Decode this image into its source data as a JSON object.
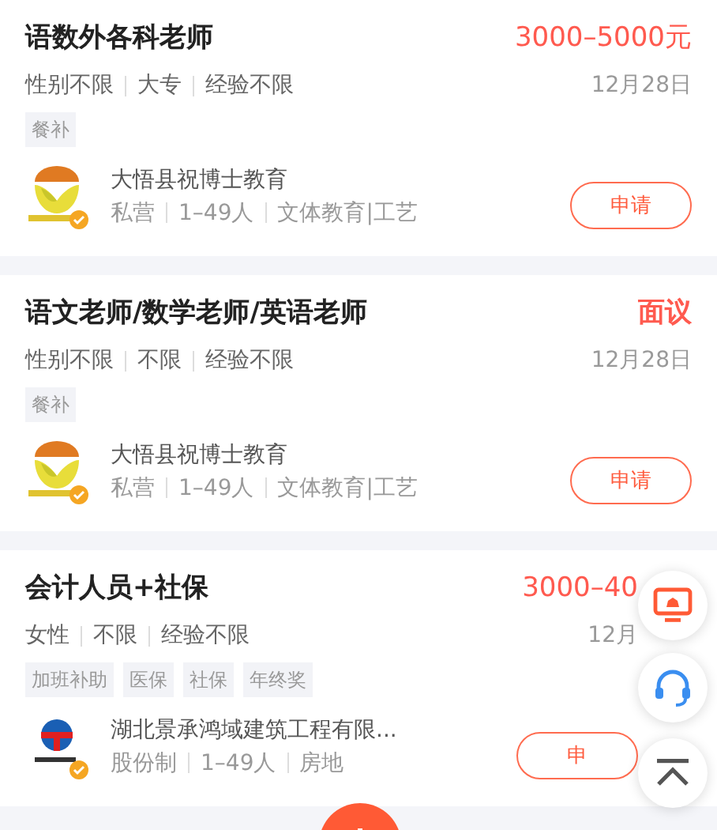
{
  "jobs": [
    {
      "title": "语数外各科老师",
      "salary": "3000–5000元",
      "requirements": [
        "性别不限",
        "大专",
        "经验不限"
      ],
      "date": "12月28日",
      "tags": [
        "餐补"
      ],
      "company": {
        "name": "大悟县祝博士教育",
        "kind": "education",
        "details": [
          "私营",
          "1–49人",
          "文体教育|工艺"
        ]
      },
      "apply": "申请"
    },
    {
      "title": "语文老师/数学老师/英语老师",
      "salary": "面议",
      "requirements": [
        "性别不限",
        "不限",
        "经验不限"
      ],
      "date": "12月28日",
      "tags": [
        "餐补"
      ],
      "company": {
        "name": "大悟县祝博士教育",
        "kind": "education",
        "details": [
          "私营",
          "1–49人",
          "文体教育|工艺"
        ]
      },
      "apply": "申请"
    },
    {
      "title": "会计人员+社保",
      "salary": "3000–40",
      "requirements": [
        "女性",
        "不限",
        "经验不限"
      ],
      "date": "12月",
      "tags": [
        "加班补助",
        "医保",
        "社保",
        "年终奖"
      ],
      "company": {
        "name": "湖北景承鸿域建筑工程有限...",
        "kind": "construction",
        "details": [
          "股份制",
          "1–49人",
          "房地"
        ]
      },
      "apply": "申"
    }
  ]
}
